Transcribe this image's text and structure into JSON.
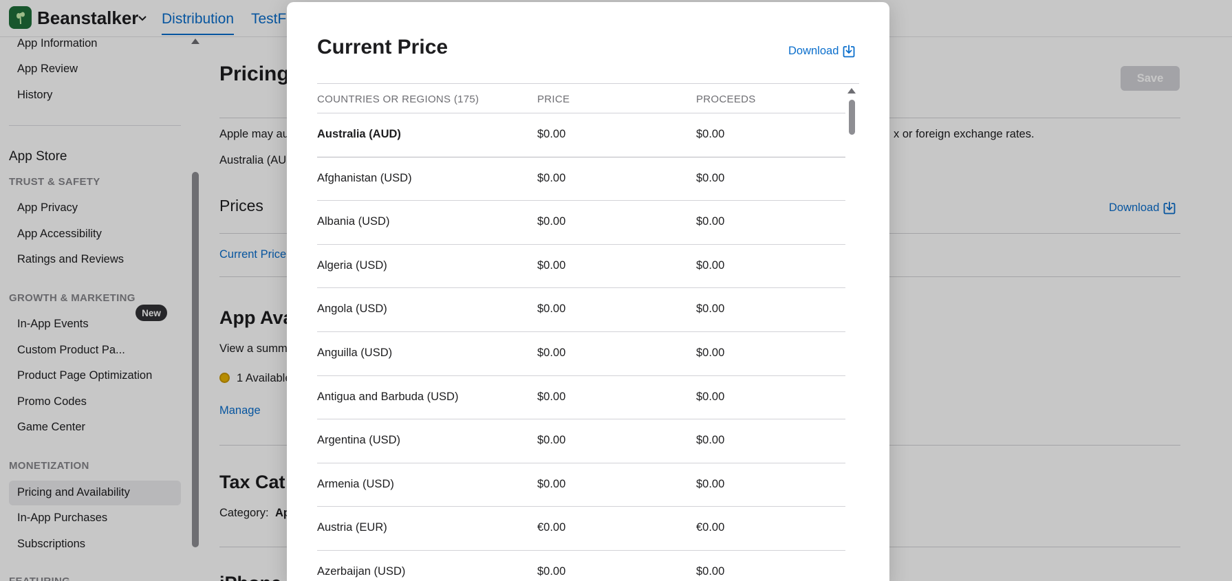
{
  "topbar": {
    "app_name": "Beanstalker",
    "tabs": [
      {
        "label": "Distribution",
        "active": true
      },
      {
        "label": "TestF",
        "active": false
      }
    ]
  },
  "sidebar": {
    "top_items": [
      "App Information",
      "App Review",
      "History"
    ],
    "section_title": "App Store",
    "groups": [
      {
        "heading": "TRUST & SAFETY",
        "items": [
          "App Privacy",
          "App Accessibility",
          "Ratings and Reviews"
        ]
      },
      {
        "heading": "GROWTH & MARKETING",
        "items": [
          "In-App Events",
          "Custom Product Pa...",
          "Product Page Optimization",
          "Promo Codes",
          "Game Center"
        ]
      },
      {
        "heading": "MONETIZATION",
        "items": [
          "Pricing and Availability",
          "In-App Purchases",
          "Subscriptions"
        ]
      },
      {
        "heading": "FEATURING",
        "items": []
      }
    ],
    "new_badge": "New",
    "selected_item": "Pricing and Availability"
  },
  "main": {
    "title": "Pricing",
    "save_label": "Save",
    "notice_start": "Apple may au",
    "notice_end": "x or foreign exchange rates.",
    "base_region": "Australia (AU",
    "prices_heading": "Prices",
    "download_label": "Download",
    "current_price_link": "Current Price",
    "availability_heading": "App Ava",
    "availability_text": "View a summ",
    "availability_count": "1 Available",
    "manage_link": "Manage",
    "tax_heading": "Tax Cat",
    "category_label": "Category:",
    "category_value": "Ap",
    "iphone_heading": "iPhone"
  },
  "modal": {
    "title": "Current Price",
    "download_label": "Download",
    "columns": [
      "COUNTRIES OR REGIONS (175)",
      "PRICE",
      "PROCEEDS"
    ],
    "rows": [
      {
        "country": "Australia (AUD)",
        "price": "$0.00",
        "proceeds": "$0.00"
      },
      {
        "country": "Afghanistan (USD)",
        "price": "$0.00",
        "proceeds": "$0.00"
      },
      {
        "country": "Albania (USD)",
        "price": "$0.00",
        "proceeds": "$0.00"
      },
      {
        "country": "Algeria (USD)",
        "price": "$0.00",
        "proceeds": "$0.00"
      },
      {
        "country": "Angola (USD)",
        "price": "$0.00",
        "proceeds": "$0.00"
      },
      {
        "country": "Anguilla (USD)",
        "price": "$0.00",
        "proceeds": "$0.00"
      },
      {
        "country": "Antigua and Barbuda (USD)",
        "price": "$0.00",
        "proceeds": "$0.00"
      },
      {
        "country": "Argentina (USD)",
        "price": "$0.00",
        "proceeds": "$0.00"
      },
      {
        "country": "Armenia (USD)",
        "price": "$0.00",
        "proceeds": "$0.00"
      },
      {
        "country": "Austria (EUR)",
        "price": "€0.00",
        "proceeds": "€0.00"
      },
      {
        "country": "Azerbaijan (USD)",
        "price": "$0.00",
        "proceeds": "$0.00"
      }
    ]
  },
  "colors": {
    "link": "#0a6ecc",
    "overlay": "rgba(0,0,0,0.22)",
    "app_icon": "#1f6f3a",
    "availability_dot": "#e9b400"
  },
  "icons": {
    "app": "beanstalk-app-icon",
    "chevron": "chevron-down-icon",
    "download": "download-icon"
  }
}
